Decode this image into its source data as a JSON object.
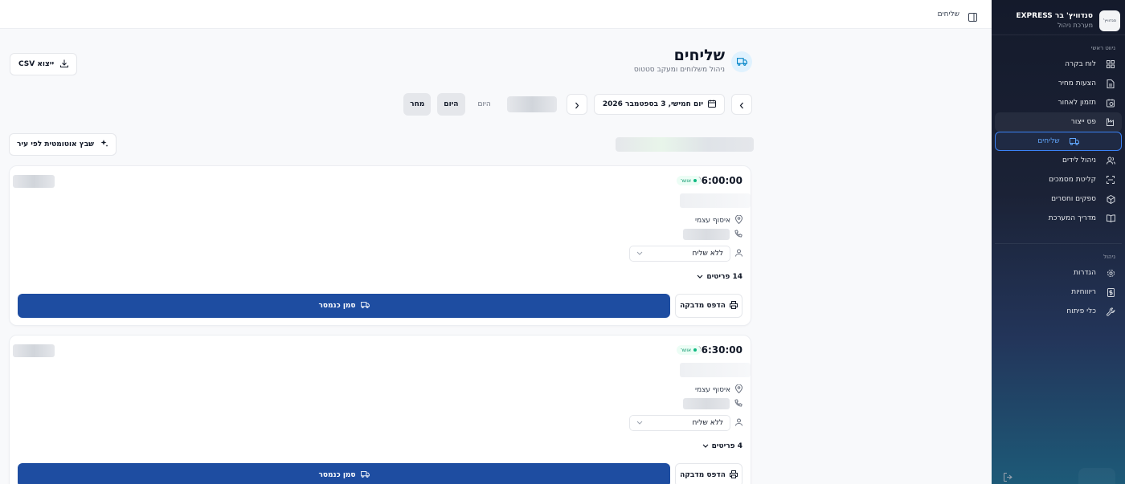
{
  "sidebar": {
    "brand_name": "סנדוויץ' בר EXPRESS",
    "brand_sub": "מערכת ניהול",
    "logo_text": "סנדוויץ'",
    "section_main": "ניווט ראשי",
    "section_admin": "ניהול",
    "items": [
      {
        "label": "לוח בקרה",
        "icon": "grid-icon"
      },
      {
        "label": "הצעות מחיר",
        "icon": "document-icon"
      },
      {
        "label": "תזמון לאחור",
        "icon": "calendar-clock-icon"
      },
      {
        "label": "פס ייצור",
        "icon": "factory-icon"
      },
      {
        "label": "שליחים",
        "icon": "truck-icon"
      },
      {
        "label": "ניהול לידים",
        "icon": "users-icon"
      },
      {
        "label": "קליטת מסמכים",
        "icon": "scan-icon"
      },
      {
        "label": "ספקים וחסרים",
        "icon": "package-icon"
      },
      {
        "label": "מדריך המערכת",
        "icon": "book-icon"
      }
    ],
    "admin_items": [
      {
        "label": "הגדרות",
        "icon": "gear-icon"
      },
      {
        "label": "ריוווחיות",
        "icon": "dollar-icon"
      },
      {
        "label": "כלי פיתוח",
        "icon": "wrench-icon"
      }
    ],
    "active_color": "#3b82f6"
  },
  "topbar": {
    "crumb": "שליחים"
  },
  "header": {
    "title": "שליחים",
    "subtitle": "ניהול משלוחים ומעקב סטטוס",
    "csv_label": "ייצוא CSV"
  },
  "date_nav": {
    "date_label": "יום חמישי, 3 בספטמבר 2026",
    "today_label": "היום",
    "today_button": "היום",
    "tomorrow_button": "מחר"
  },
  "auto_assign_label": "שבץ אוטומטית לפי עיר",
  "cards": [
    {
      "time": "06:00:00",
      "status": "אושר",
      "pickup": "איסוף עצמי",
      "courier": "ללא שליח",
      "items": "14 פריטים",
      "print_label": "הדפס מדבקה",
      "mark_label": "סמן כנמסר"
    },
    {
      "time": "06:30:00",
      "status": "אושר",
      "pickup": "איסוף עצמי",
      "courier": "ללא שליח",
      "items": "4 פריטים",
      "print_label": "הדפס מדבקה",
      "mark_label": "סמן כנמסר"
    }
  ],
  "colors": {
    "primary": "#1e4da1",
    "status_green": "#10b981"
  }
}
